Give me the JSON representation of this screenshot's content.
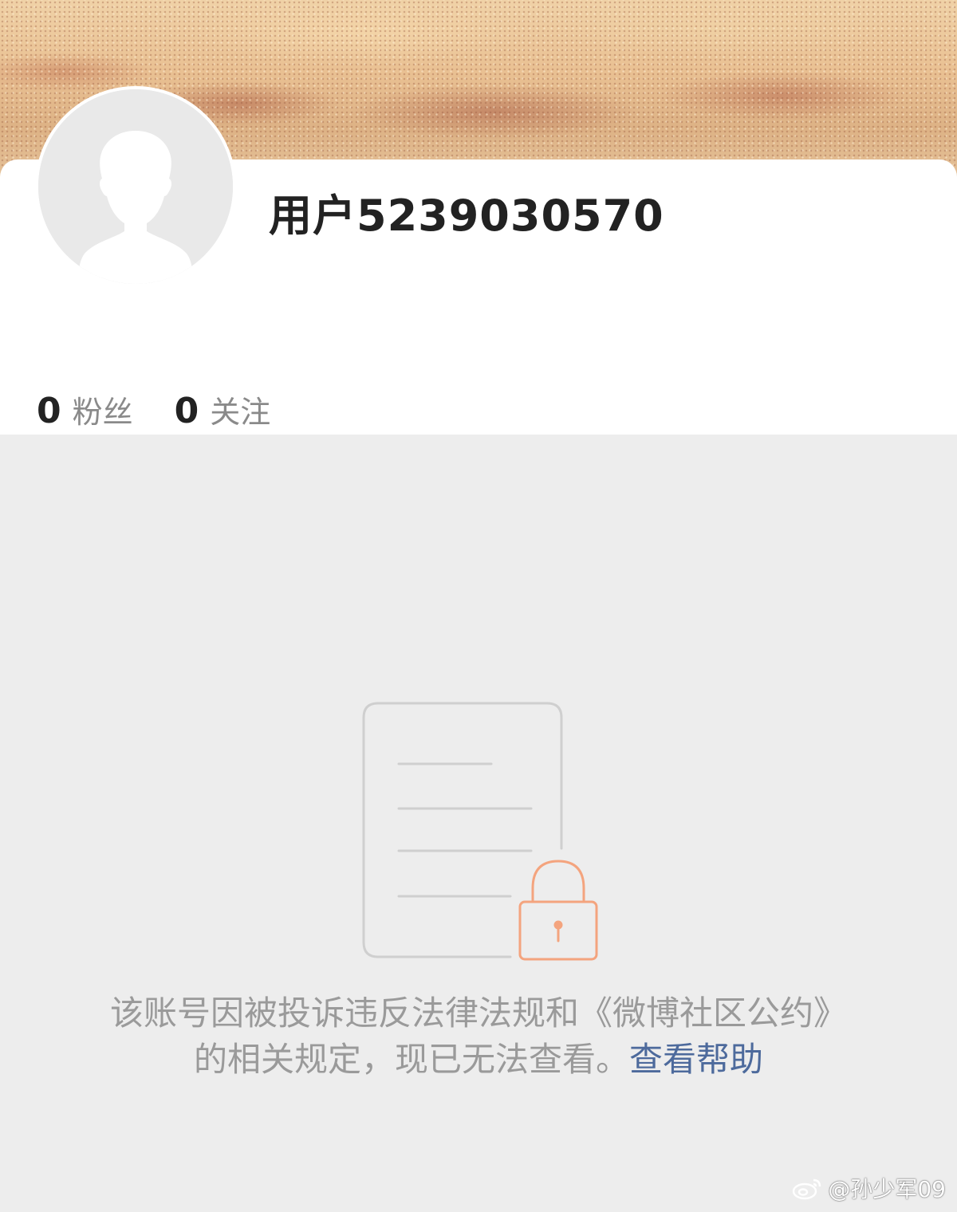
{
  "profile": {
    "username": "用户5239030570",
    "followers_count": "0",
    "followers_label": "粉丝",
    "following_count": "0",
    "following_label": "关注"
  },
  "notice": {
    "text": "该账号因被投诉违反法律法规和《微博社区公约》的相关规定，现已无法查看。",
    "help_link": "查看帮助"
  },
  "watermark": {
    "text": "@孙少军09",
    "icon": "weibo-logo-icon"
  },
  "colors": {
    "lock_accent": "#f4a47e",
    "link": "#4d6a9c",
    "muted_text": "#9a9a9a"
  }
}
